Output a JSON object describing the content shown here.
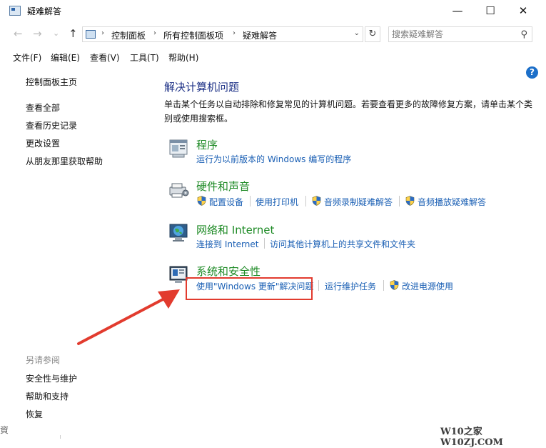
{
  "window": {
    "title": "疑难解答",
    "minimize": "—",
    "maximize": "☐",
    "close": "✕"
  },
  "address": {
    "back": "←",
    "forward": "→",
    "dropdown": "⌄",
    "up": "↑",
    "breadcrumbs": [
      "控制面板",
      "所有控制面板项",
      "疑难解答"
    ],
    "refresh": "↻",
    "search_placeholder": "搜索疑难解答"
  },
  "menu": [
    "文件(F)",
    "编辑(E)",
    "查看(V)",
    "工具(T)",
    "帮助(H)"
  ],
  "sidebar": {
    "home": "控制面板主页",
    "items": [
      "查看全部",
      "查看历史记录",
      "更改设置",
      "从朋友那里获取帮助"
    ],
    "see_also_title": "另请参阅",
    "see_also": [
      "安全性与维护",
      "帮助和支持",
      "恢复"
    ]
  },
  "help_icon": "?",
  "main": {
    "title": "解决计算机问题",
    "description": "单击某个任务以自动排除和修复常见的计算机问题。若要查看更多的故障修复方案，请单击某个类别或使用搜索框。",
    "categories": [
      {
        "title": "程序",
        "icon": "programs-icon",
        "links": [
          "运行为以前版本的 Windows 编写的程序"
        ]
      },
      {
        "title": "硬件和声音",
        "icon": "hardware-sound-icon",
        "links": [
          "配置设备",
          "使用打印机",
          "音频录制疑难解答",
          "音频播放疑难解答"
        ]
      },
      {
        "title": "网络和 Internet",
        "icon": "network-internet-icon",
        "links": [
          "连接到 Internet",
          "访问其他计算机上的共享文件和文件夹"
        ]
      },
      {
        "title": "系统和安全性",
        "icon": "system-security-icon",
        "links": [
          "使用\"Windows 更新\"解决问题",
          "运行维护任务",
          "改进电源使用"
        ]
      }
    ]
  },
  "colors": {
    "link": "#1a5fb4",
    "category_title": "#1d8a25",
    "page_title": "#1e3287",
    "annotation": "#e23b2e"
  },
  "watermark": "W10之家 W10ZJ.COM",
  "cut_char": "資"
}
